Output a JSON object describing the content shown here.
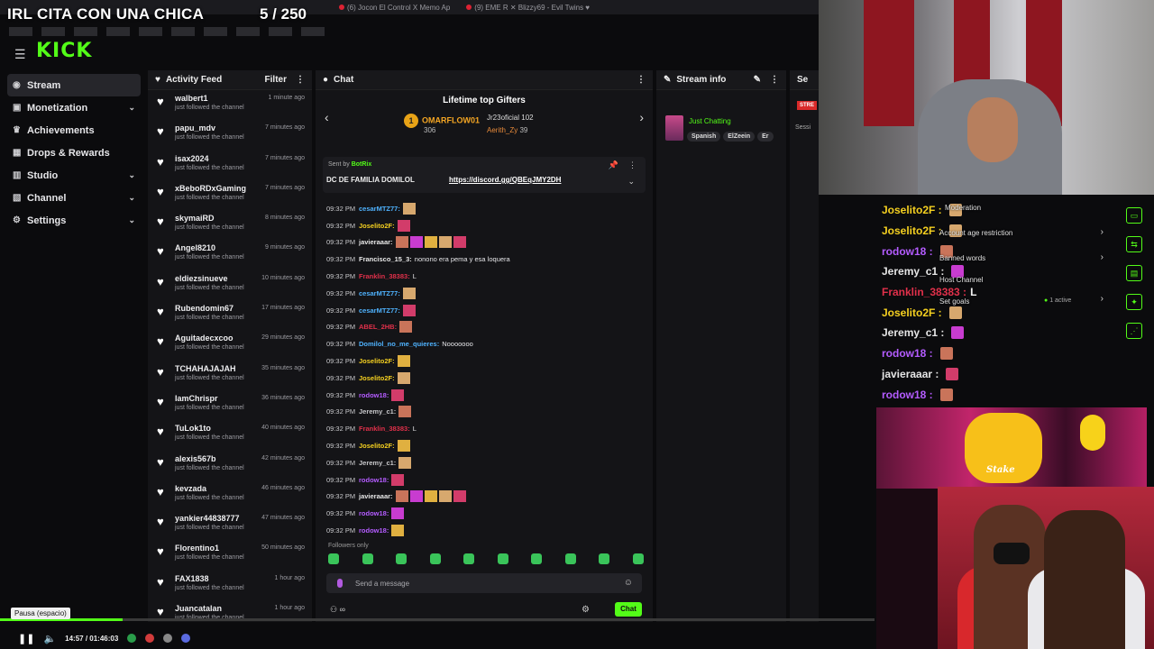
{
  "overlay": {
    "title": "IRL CITA CON UNA CHICA",
    "count": "5 / 250"
  },
  "browser": {
    "tabs": [
      "(6) Jocon El Control X Memo Ap",
      "(9) EME R ✕ Blizzy69 - Evil Twins ♥"
    ]
  },
  "header": {
    "logo": "KICK"
  },
  "nav": [
    {
      "label": "Stream",
      "icon": "stream-icon",
      "active": true,
      "chev": false
    },
    {
      "label": "Monetization",
      "icon": "monetization-icon",
      "active": false,
      "chev": true
    },
    {
      "label": "Achievements",
      "icon": "trophy-icon",
      "active": false,
      "chev": false
    },
    {
      "label": "Drops & Rewards",
      "icon": "gift-icon",
      "active": false,
      "chev": false
    },
    {
      "label": "Studio",
      "icon": "studio-icon",
      "active": false,
      "chev": true
    },
    {
      "label": "Channel",
      "icon": "channel-icon",
      "active": false,
      "chev": true
    },
    {
      "label": "Settings",
      "icon": "gear-icon",
      "active": false,
      "chev": true
    }
  ],
  "feed": {
    "title": "Activity Feed",
    "filter": "Filter",
    "items": [
      {
        "user": "walbert1",
        "desc": "just followed the channel",
        "time": "1 minute ago"
      },
      {
        "user": "papu_mdv",
        "desc": "just followed the channel",
        "time": "7 minutes ago"
      },
      {
        "user": "isax2024",
        "desc": "just followed the channel",
        "time": "7 minutes ago"
      },
      {
        "user": "xBeboRDxGaming",
        "desc": "just followed the channel",
        "time": "7 minutes ago"
      },
      {
        "user": "skymaiRD",
        "desc": "just followed the channel",
        "time": "8 minutes ago"
      },
      {
        "user": "Angel8210",
        "desc": "just followed the channel",
        "time": "9 minutes ago"
      },
      {
        "user": "eldiezsinueve",
        "desc": "just followed the channel",
        "time": "10 minutes ago"
      },
      {
        "user": "Rubendomin67",
        "desc": "just followed the channel",
        "time": "17 minutes ago"
      },
      {
        "user": "Aguitadecxcoo",
        "desc": "just followed the channel",
        "time": "29 minutes ago"
      },
      {
        "user": "TCHAHAJAJAH",
        "desc": "just followed the channel",
        "time": "35 minutes ago"
      },
      {
        "user": "IamChrispr",
        "desc": "just followed the channel",
        "time": "36 minutes ago"
      },
      {
        "user": "TuLok1to",
        "desc": "just followed the channel",
        "time": "40 minutes ago"
      },
      {
        "user": "alexis567b",
        "desc": "just followed the channel",
        "time": "42 minutes ago"
      },
      {
        "user": "kevzada",
        "desc": "just followed the channel",
        "time": "46 minutes ago"
      },
      {
        "user": "yankier44838777",
        "desc": "just followed the channel",
        "time": "47 minutes ago"
      },
      {
        "user": "Florentino1",
        "desc": "just followed the channel",
        "time": "50 minutes ago"
      },
      {
        "user": "FAX1838",
        "desc": "just followed the channel",
        "time": "1 hour ago"
      },
      {
        "user": "Juancatalan",
        "desc": "just followed the channel",
        "time": "1 hour ago"
      }
    ]
  },
  "chat": {
    "title": "Chat",
    "gifters_title": "Lifetime top Gifters",
    "gifters": [
      {
        "name": "OMARFLOW01",
        "count": "306"
      },
      {
        "name": "Jr23oficial",
        "count": "102"
      },
      {
        "name": "Aerith_Zy",
        "count": "39"
      }
    ],
    "pinned": {
      "sent_by": "Sent by",
      "bot": "BotRix",
      "text": "DC DE FAMILIA DOMILOL",
      "link": "https://discord.gg/QBEqJMY2DH"
    },
    "messages": [
      {
        "time": "09:32 PM",
        "user": "cesarMTZ77:",
        "color": "#4fb3ff",
        "text": "",
        "emotes": 1
      },
      {
        "time": "09:32 PM",
        "user": "Joselito2F:",
        "color": "#f5d020",
        "text": "",
        "emotes": 1
      },
      {
        "time": "09:32 PM",
        "user": "javieraaar:",
        "color": "#e8e8e8",
        "text": "",
        "emotes": 5
      },
      {
        "time": "09:32 PM",
        "user": "Francisco_15_3:",
        "color": "#e8e8e8",
        "text": "nonono era pema y esa loquera",
        "emotes": 0
      },
      {
        "time": "09:32 PM",
        "user": "Franklin_38383:",
        "color": "#e0304a",
        "text": "L",
        "emotes": 0
      },
      {
        "time": "09:32 PM",
        "user": "cesarMTZ77:",
        "color": "#4fb3ff",
        "text": "",
        "emotes": 1
      },
      {
        "time": "09:32 PM",
        "user": "cesarMTZ77:",
        "color": "#4fb3ff",
        "text": "",
        "emotes": 1
      },
      {
        "time": "09:32 PM",
        "user": "ABEL_2HB:",
        "color": "#e0304a",
        "text": "",
        "emotes": 1
      },
      {
        "time": "09:32 PM",
        "user": "Domilol_no_me_quieres:",
        "color": "#4fb3ff",
        "text": "Nooooooo",
        "emotes": 0
      },
      {
        "time": "09:32 PM",
        "user": "Joselito2F:",
        "color": "#f5d020",
        "text": "",
        "emotes": 1
      },
      {
        "time": "09:32 PM",
        "user": "Joselito2F:",
        "color": "#f5d020",
        "text": "",
        "emotes": 1
      },
      {
        "time": "09:32 PM",
        "user": "rodow18:",
        "color": "#b45cff",
        "text": "",
        "emotes": 1
      },
      {
        "time": "09:32 PM",
        "user": "Jeremy_c1:",
        "color": "#c9c9cc",
        "text": "",
        "emotes": 1
      },
      {
        "time": "09:32 PM",
        "user": "Franklin_38383:",
        "color": "#e0304a",
        "text": "L",
        "emotes": 0
      },
      {
        "time": "09:32 PM",
        "user": "Joselito2F:",
        "color": "#f5d020",
        "text": "",
        "emotes": 1
      },
      {
        "time": "09:32 PM",
        "user": "Jeremy_c1:",
        "color": "#c9c9cc",
        "text": "",
        "emotes": 1
      },
      {
        "time": "09:32 PM",
        "user": "rodow18:",
        "color": "#b45cff",
        "text": "",
        "emotes": 1
      },
      {
        "time": "09:32 PM",
        "user": "javieraaar:",
        "color": "#e8e8e8",
        "text": "",
        "emotes": 5
      },
      {
        "time": "09:32 PM",
        "user": "rodow18:",
        "color": "#b45cff",
        "text": "",
        "emotes": 1
      },
      {
        "time": "09:32 PM",
        "user": "rodow18:",
        "color": "#b45cff",
        "text": "",
        "emotes": 1
      }
    ],
    "followers_only": "Followers only",
    "placeholder": "Send a message",
    "chat_button": "Chat",
    "footer_count": "∞"
  },
  "stream_info": {
    "title": "Stream info",
    "category": "Just Chatting",
    "tags": [
      "Spanish",
      "ElZeein",
      "Er"
    ]
  },
  "session": {
    "title": "Se",
    "badge": "STRE",
    "label": "Sessi"
  },
  "rchat": {
    "lines": [
      {
        "user": "Joselito2F :",
        "color": "#f5d020",
        "text": "",
        "emote": "#d7a86e"
      },
      {
        "user": "Joselito2F :",
        "color": "#f5d020",
        "text": "",
        "emote": "#d7a86e"
      },
      {
        "user": "rodow18 :",
        "color": "#b45cff",
        "text": "",
        "emote": "#c9745a"
      },
      {
        "user": "Jeremy_c1 :",
        "color": "#e6e6e6",
        "text": "",
        "emote": "#c83cd0"
      },
      {
        "user": "Franklin_38383 :",
        "color": "#e0304a",
        "text": "L",
        "emote": ""
      },
      {
        "user": "Joselito2F :",
        "color": "#f5d020",
        "text": "",
        "emote": "#d7a86e"
      },
      {
        "user": "Jeremy_c1 :",
        "color": "#e6e6e6",
        "text": "",
        "emote": "#c83cd0"
      },
      {
        "user": "rodow18 :",
        "color": "#b45cff",
        "text": "",
        "emote": "#c9745a"
      },
      {
        "user": "javieraaar :",
        "color": "#e6e6e6",
        "text": "",
        "emote": "#d23c6a"
      },
      {
        "user": "rodow18 :",
        "color": "#b45cff",
        "text": "",
        "emote": "#c9745a"
      }
    ],
    "labels": {
      "moderation": "Moderation",
      "age": "Account age restriction",
      "banned": "Banned words",
      "host": "Host Channel",
      "goals": "Set goals",
      "active": "1 active"
    }
  },
  "stake": {
    "brand": "Stake"
  },
  "player": {
    "tooltip": "Pausa (espacio)",
    "time": "14:57 / 01:46:03",
    "progress": 0.14
  },
  "colors": {
    "accent": "#53fc18"
  }
}
